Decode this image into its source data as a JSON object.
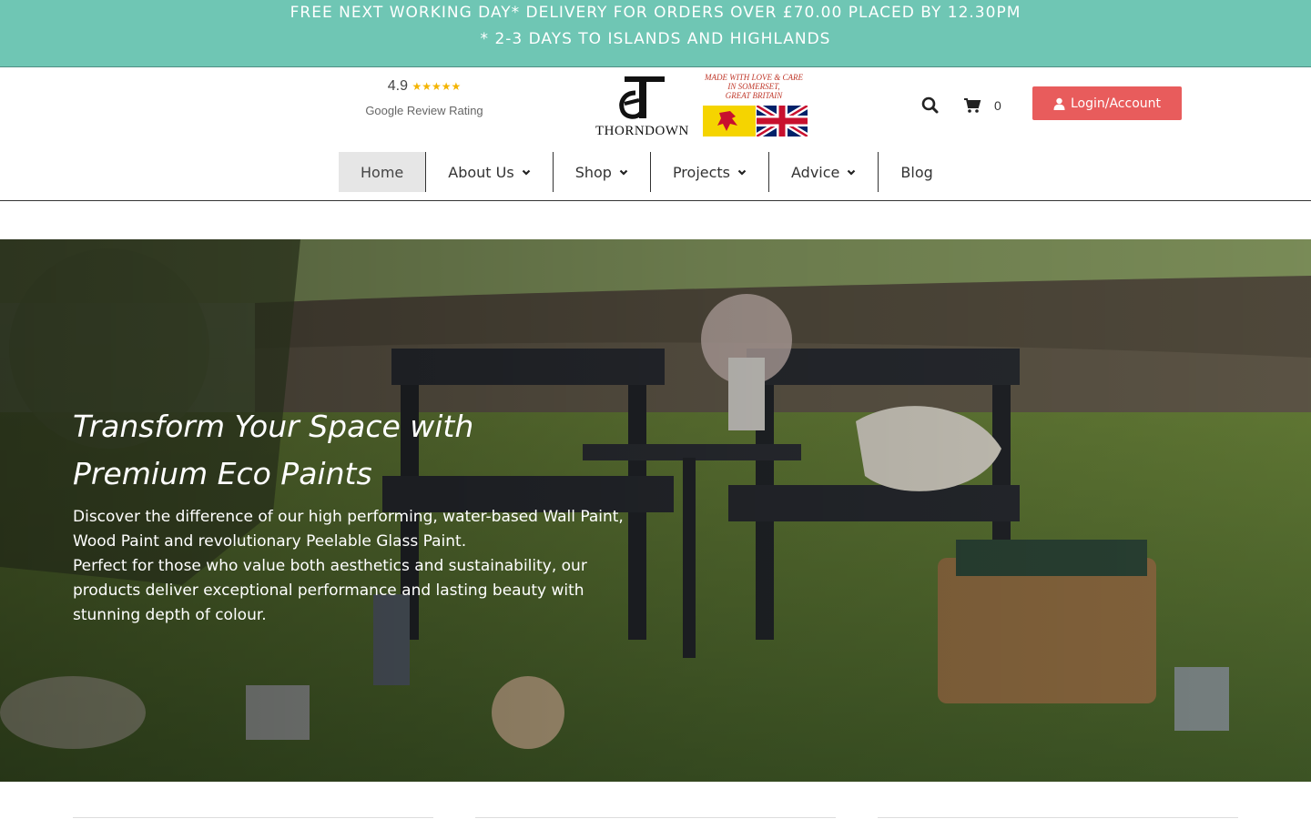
{
  "banner": {
    "line1": "FREE NEXT WORKING DAY* DELIVERY FOR ORDERS OVER £70.00 PLACED BY 12.30PM",
    "line2": "* 2-3 DAYS TO ISLANDS AND HIGHLANDS",
    "color": "#6fc6b4"
  },
  "rating": {
    "score": "4.9",
    "stars": "★★★★★",
    "caption": "Google Review Rating"
  },
  "logo": {
    "brand": "THORNDOWN",
    "tagline_1": "MADE WITH LOVE & CARE",
    "tagline_2": "IN SOMERSET,",
    "tagline_3": "GREAT BRITAIN"
  },
  "header": {
    "search_icon": "search-icon",
    "cart_icon": "cart-icon",
    "cart_count": "0",
    "login_label": "Login/Account",
    "login_color": "#e85c5c"
  },
  "nav": {
    "items": [
      {
        "label": "Home"
      },
      {
        "label": "About Us"
      },
      {
        "label": "Shop"
      },
      {
        "label": "Projects"
      },
      {
        "label": "Advice"
      },
      {
        "label": "Blog"
      }
    ]
  },
  "hero": {
    "title_line1": "Transform Your Space with",
    "title_line2": "Premium Eco Paints",
    "body_1": "Discover the difference of our high performing, water-based Wall Paint, Wood Paint and revolutionary Peelable Glass Paint.",
    "body_2": "Perfect for those who value both aesthetics and sustainability, our products deliver exceptional performance and lasting beauty with stunning depth of colour."
  }
}
